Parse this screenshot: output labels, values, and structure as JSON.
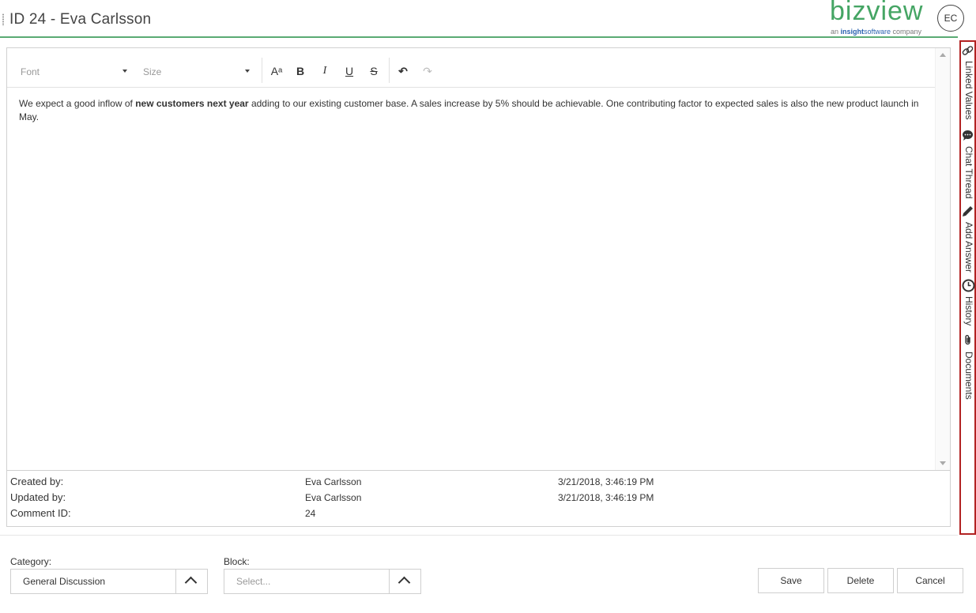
{
  "header": {
    "title": "ID 24 - Eva Carlsson",
    "brand": {
      "word": "bizview",
      "sub_prefix": "an ",
      "sub_highlight": "insight",
      "sub_mid": "software",
      "sub_suffix": " company"
    },
    "avatar_initials": "EC"
  },
  "toolbar": {
    "font_placeholder": "Font",
    "size_placeholder": "Size",
    "font_color_glyph": "Aᵃ",
    "bold_glyph": "B",
    "italic_glyph": "I",
    "underline_glyph": "U",
    "strike_glyph": "S",
    "undo_glyph": "↶",
    "redo_glyph": "↷"
  },
  "editor": {
    "text_before": "We expect a good inflow of ",
    "text_bold": "new customers next year",
    "text_after": " adding to our existing customer base. A sales increase by 5% should be achievable. One contributing factor to expected sales is also the new product launch in May."
  },
  "meta": [
    {
      "label": "Created by:",
      "value": "Eva Carlsson",
      "date": "3/21/2018, 3:46:19 PM"
    },
    {
      "label": "Updated by:",
      "value": "Eva Carlsson",
      "date": "3/21/2018, 3:46:19 PM"
    },
    {
      "label": "Comment ID:",
      "value": "24",
      "date": ""
    }
  ],
  "form": {
    "category_label": "Category:",
    "category_value": "General Discussion",
    "block_label": "Block:",
    "block_placeholder": "Select..."
  },
  "buttons": {
    "save": "Save",
    "delete": "Delete",
    "cancel": "Cancel"
  },
  "side_panel": [
    {
      "icon": "link-icon",
      "label": "Linked Values"
    },
    {
      "icon": "chat-icon",
      "label": "Chat Thread"
    },
    {
      "icon": "pencil-icon",
      "label": "Add Answer"
    },
    {
      "icon": "clock-icon",
      "label": "History"
    },
    {
      "icon": "paperclip-icon",
      "label": "Documents"
    }
  ],
  "colors": {
    "accent_green": "#45a564",
    "panel_border": "#b22222",
    "brand_blue": "#2b62b0"
  }
}
